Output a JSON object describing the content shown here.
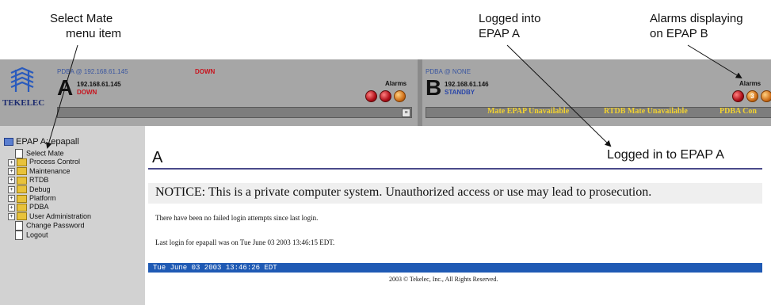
{
  "callouts": {
    "select_mate": [
      "Select Mate",
      "menu item"
    ],
    "logged_into": [
      "Logged into",
      "EPAP A"
    ],
    "alarms_b": [
      "Alarms displaying",
      "on EPAP B"
    ]
  },
  "banner": {
    "logo_text": "TEKELEC",
    "epap_a": {
      "pdba": "PDBA @ 192.168.61.145",
      "pdba_status": "DOWN",
      "letter": "A",
      "ip": "192.168.61.145",
      "state": "DOWN",
      "alarms_label": "Alarms"
    },
    "epap_b": {
      "pdba": "PDBA @ NONE",
      "letter": "B",
      "ip": "192.168.61.146",
      "state": "STANDBY",
      "alarms_label": "Alarms",
      "alarm_count": "3",
      "status_messages": [
        "Mate EPAP Unavailable",
        "RTDB Mate Unavailable",
        "PDBA Con"
      ]
    },
    "colors": {
      "banner": "#a6a6a6",
      "status_text": "#f2d230",
      "down": "#c8141e",
      "standby": "#2a46a8"
    }
  },
  "sidebar": {
    "root": "EPAP A: epapall",
    "items": [
      {
        "label": "Select Mate",
        "type": "doc"
      },
      {
        "label": "Process Control",
        "type": "folder"
      },
      {
        "label": "Maintenance",
        "type": "folder"
      },
      {
        "label": "RTDB",
        "type": "folder"
      },
      {
        "label": "Debug",
        "type": "folder"
      },
      {
        "label": "Platform",
        "type": "folder"
      },
      {
        "label": "PDBA",
        "type": "folder"
      },
      {
        "label": "User Administration",
        "type": "folder"
      },
      {
        "label": "Change Password",
        "type": "doc"
      },
      {
        "label": "Logout",
        "type": "doc"
      }
    ]
  },
  "main": {
    "title": "A",
    "logged_msg": "Logged in to EPAP A",
    "notice": "NOTICE: This is a private computer system. Unauthorized access or use may lead to prosecution.",
    "failed_logins": "There have been no failed login attempts since last login.",
    "last_login": "Last login for epapall was on Tue June 03 2003 13:46:15 EDT.",
    "footer_time": "Tue June 03 2003 13:46:26 EDT",
    "copyright": "2003 © Tekelec, Inc., All Rights Reserved."
  }
}
